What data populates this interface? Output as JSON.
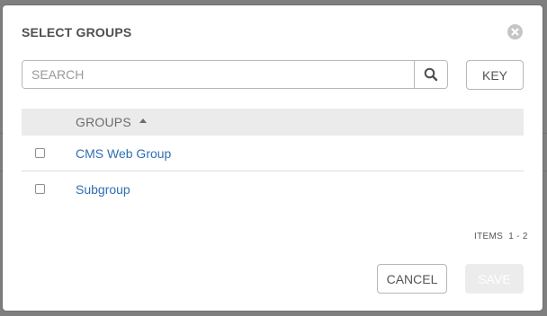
{
  "modal": {
    "title": "SELECT GROUPS"
  },
  "search": {
    "placeholder": "SEARCH",
    "value": ""
  },
  "key_button": {
    "label": "KEY"
  },
  "table": {
    "column_header": "GROUPS",
    "sort": "ascending",
    "rows": [
      {
        "name": "CMS Web Group",
        "checked": false
      },
      {
        "name": "Subgroup",
        "checked": false
      }
    ]
  },
  "pagination": {
    "label": "ITEMS  1 - 2"
  },
  "footer": {
    "cancel_label": "CANCEL",
    "save_label": "SAVE"
  },
  "icons": {
    "close": "close-icon",
    "search": "search-icon",
    "sort": "sort-ascending-icon"
  },
  "colors": {
    "link": "#2f6fb4",
    "header_bg": "#ebebeb",
    "disabled_button": "#ececec"
  }
}
